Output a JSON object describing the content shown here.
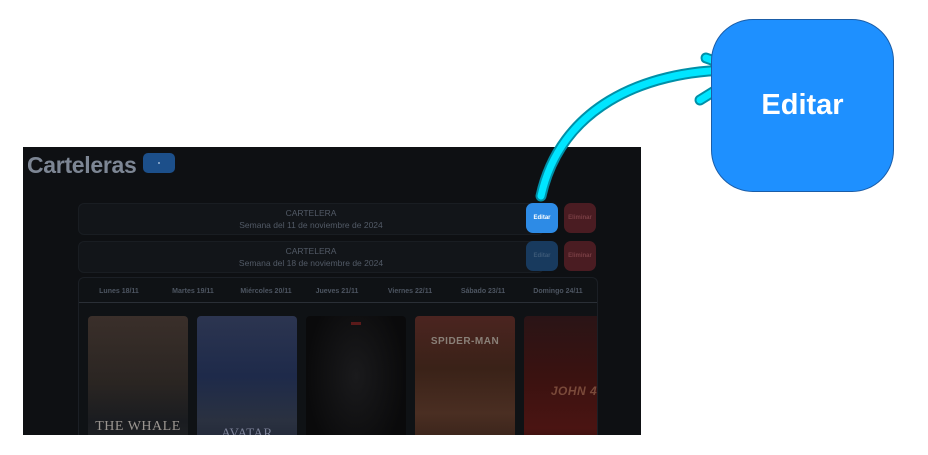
{
  "page": {
    "title": "Carteleras"
  },
  "carteleras": [
    {
      "label": "CARTELERA",
      "week": "Semana del 11 de noviembre de 2024",
      "edit_label": "Editar",
      "delete_label": "Eliminar"
    },
    {
      "label": "CARTELERA",
      "week": "Semana del 18 de noviembre de 2024",
      "edit_label": "Editar",
      "delete_label": "Eliminar"
    }
  ],
  "schedule": {
    "days": [
      "Lunes 18/11",
      "Martes 19/11",
      "Miércoles 20/11",
      "Jueves 21/11",
      "Viernes 22/11",
      "Sábado 23/11",
      "Domingo 24/11"
    ],
    "posters": [
      {
        "icon": "whale-movie-poster",
        "title": "THE WHALE"
      },
      {
        "icon": "avatar-movie-poster",
        "title": "AVATAR"
      },
      {
        "icon": "black-panther-movie-poster",
        "title": ""
      },
      {
        "icon": "spider-man-movie-poster",
        "title": "SPIDER-MAN"
      },
      {
        "icon": "john-wick-movie-poster",
        "title": "JOHN 4"
      }
    ]
  },
  "callout": {
    "label": "Editar"
  },
  "colors": {
    "accent": "#1e90ff",
    "arrow": "#00e5ff",
    "danger": "#4a1c22",
    "background": "#0e1013"
  }
}
